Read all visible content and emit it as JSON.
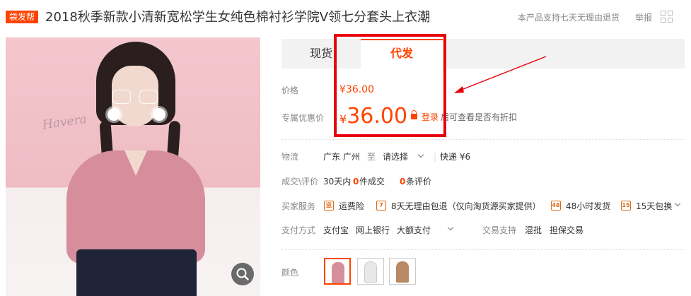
{
  "header": {
    "badge": "袋发帮",
    "title": "2018秋季新款小清新宽松学生女纯色棉衬衫学院V领七分套头上衣潮",
    "return_note": "本产品支持七天无理由退货",
    "report": "举报"
  },
  "tabs": [
    {
      "label": "现货"
    },
    {
      "label": "代发"
    }
  ],
  "price": {
    "label": "价格",
    "value": "¥36.00"
  },
  "member_price": {
    "label": "专属优惠价",
    "currency": "¥",
    "amount": "36.00",
    "login": "登录",
    "hint": "后可查看是否有折扣"
  },
  "logistics": {
    "label": "物流",
    "from": "广东 广州",
    "to_word": "至",
    "select": "请选择",
    "express": "快递 ¥6"
  },
  "deals": {
    "label": "成交\\评价",
    "period": "30天内",
    "sold_count": "0",
    "sold_suffix": "件成交",
    "review_count": "0",
    "review_suffix": "条评价"
  },
  "buyer_service": {
    "label": "买家服务",
    "items": [
      {
        "icon": "freight-insurance-icon",
        "glyph": "运",
        "text": "运费险"
      },
      {
        "icon": "seven-day-return-icon",
        "glyph": "7",
        "text": "8天无理由包退（仅向淘货源买家提供）"
      },
      {
        "icon": "48h-ship-icon",
        "glyph": "48",
        "text": "48小时发货"
      },
      {
        "icon": "15day-exchange-icon",
        "glyph": "15",
        "text": "15天包换"
      }
    ]
  },
  "payment": {
    "label": "支付方式",
    "methods": [
      "支付宝",
      "网上银行",
      "大额支付"
    ],
    "trade_label": "交易支持",
    "trade_items": [
      "混批",
      "担保交易"
    ]
  },
  "color": {
    "label": "颜色",
    "swatches": [
      {
        "name": "pink",
        "color": "#d68d9c"
      },
      {
        "name": "white",
        "color": "#e8e8ea"
      },
      {
        "name": "khaki",
        "color": "#b88a63"
      }
    ]
  },
  "colors": {
    "accent": "#ff4400",
    "annotation": "#e8000b"
  }
}
